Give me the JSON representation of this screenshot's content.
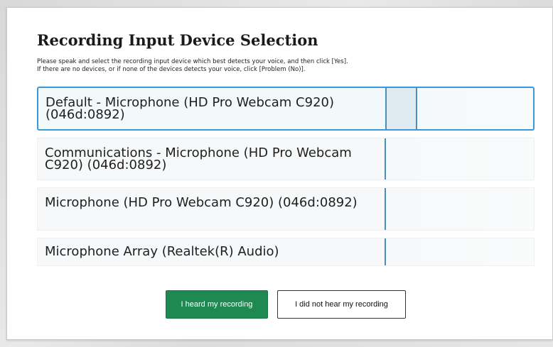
{
  "dialog": {
    "title": "Recording Input Device Selection",
    "instructions": [
      "Please speak and select the recording input device which best detects your voice, and then click [Yes].",
      "If there are no devices, or if none of the devices detects your voice, click [Problem (No)]."
    ]
  },
  "devices": [
    {
      "label": "Default - Microphone (HD Pro Webcam C920) (046d:0892)",
      "selected": true,
      "level": 0.2
    },
    {
      "label": "Communications - Microphone (HD Pro Webcam C920) (046d:0892)",
      "selected": false,
      "level": 0
    },
    {
      "label": "Microphone (HD Pro Webcam C920) (046d:0892)",
      "selected": false,
      "level": 0
    },
    {
      "label": "Microphone Array (Realtek(R) Audio)",
      "selected": false,
      "level": 0
    }
  ],
  "buttons": {
    "heard": "I heard my recording",
    "not_heard": "I did not hear my recording"
  },
  "colors": {
    "accent": "#3a9ad9",
    "meter_line": "#4a8fb8",
    "primary_button": "#1e8a52"
  }
}
